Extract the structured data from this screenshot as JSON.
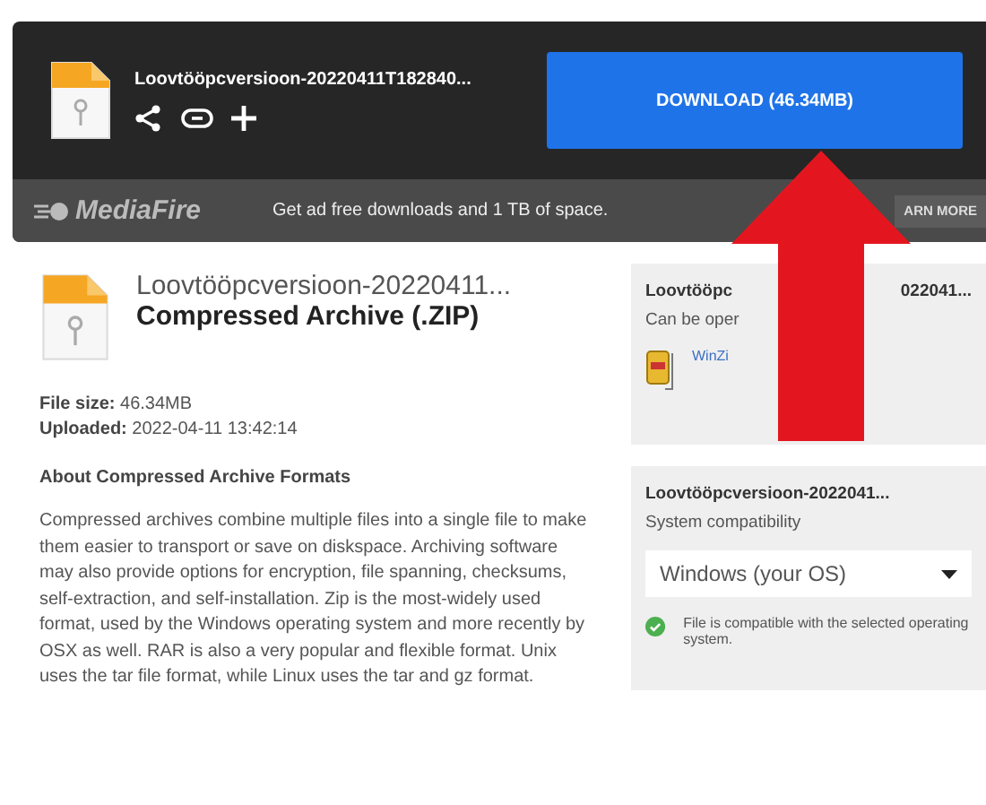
{
  "header": {
    "file_name": "Loovtööpcversioon-20220411T182840...",
    "download_button": "DOWNLOAD (46.34MB)"
  },
  "promo_bar": {
    "logo": "MediaFire",
    "message": "Get ad free downloads and 1 TB of space.",
    "button": "ARN MORE"
  },
  "file": {
    "name": "Loovtööpcversioon-20220411...",
    "type": "Compressed Archive (.ZIP)",
    "size_label": "File size:",
    "size": "46.34MB",
    "uploaded_label": "Uploaded:",
    "uploaded": "2022-04-11 13:42:14"
  },
  "about": {
    "title": "About Compressed Archive Formats",
    "body": "Compressed archives combine multiple files into a single file to make them easier to transport or save on diskspace. Archiving software may also provide options for encryption, file spanning, checksums, self-extraction, and self-installation. Zip is the most-widely used format, used by the Windows operating system and more recently by OSX as well. RAR is also a very popular and flexible format. Unix uses the tar file format, while Linux uses the tar and gz format."
  },
  "open_card": {
    "title_start": "Loovtööpc",
    "title_end": "022041...",
    "subtitle": "Can be oper",
    "app_link": "WinZi"
  },
  "compat_card": {
    "title": "Loovtööpcversioon-2022041...",
    "subtitle": "System compatibility",
    "os_select": "Windows (your OS)",
    "compatible": true,
    "message": "File is compatible with the selected operating system."
  }
}
